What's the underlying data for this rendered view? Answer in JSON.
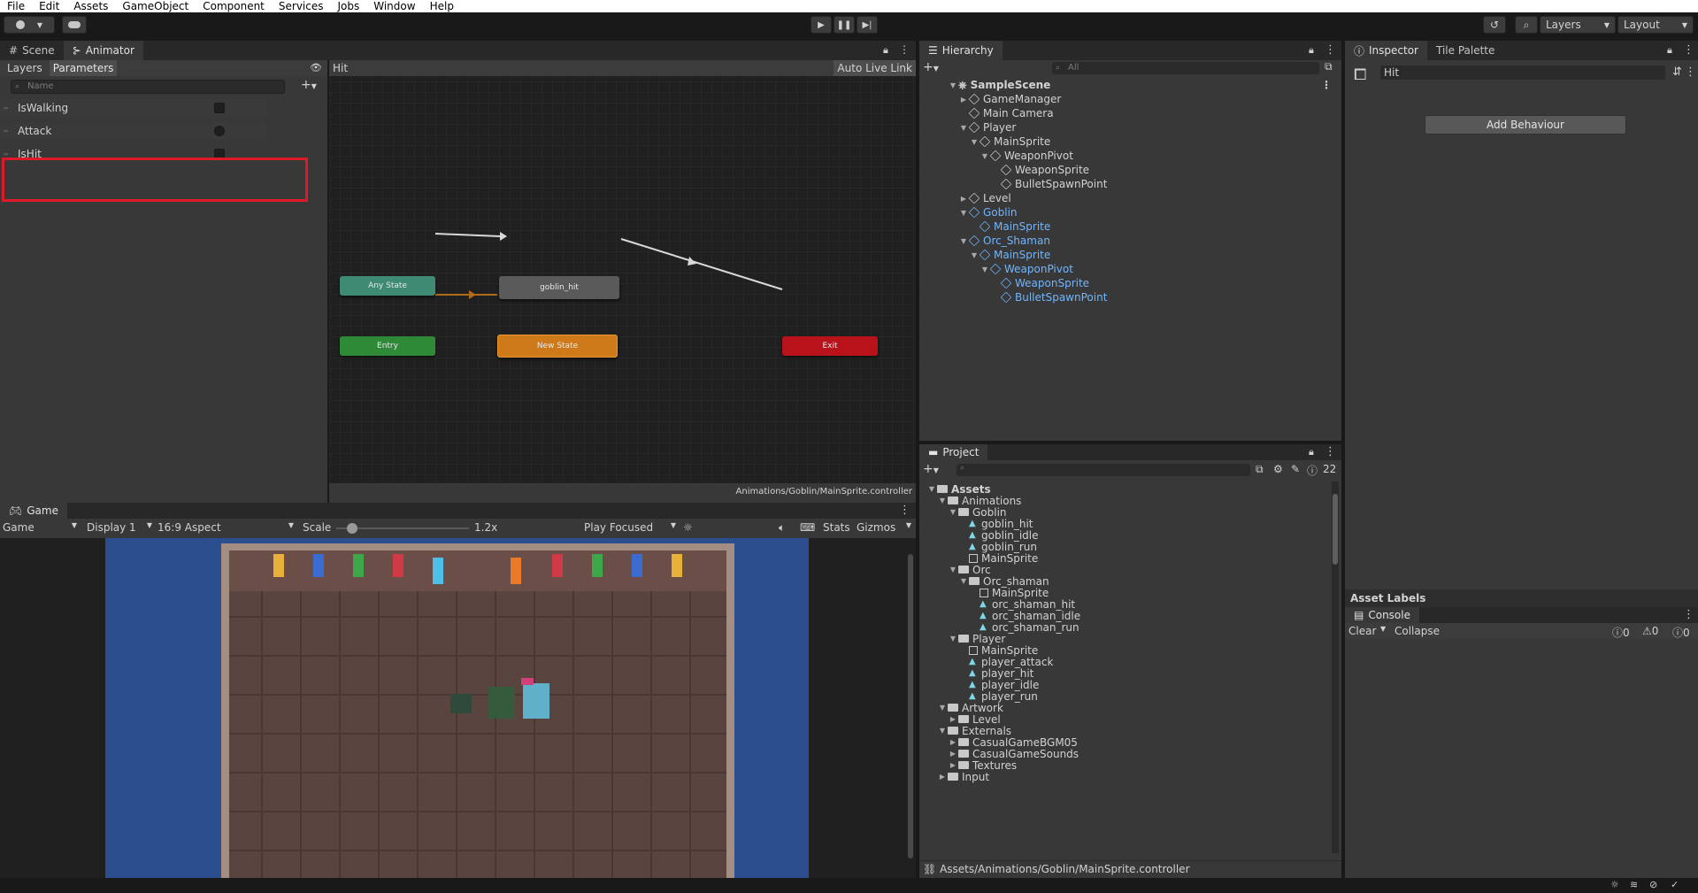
{
  "menu": [
    "File",
    "Edit",
    "Assets",
    "GameObject",
    "Component",
    "Services",
    "Jobs",
    "Window",
    "Help"
  ],
  "toolbar": {
    "layers": "Layers",
    "layout": "Layout"
  },
  "animator": {
    "tabs": {
      "scene": "Scene",
      "animator": "Animator"
    },
    "subtabs": {
      "layers": "Layers",
      "parameters": "Parameters"
    },
    "search_placeholder": "Name",
    "layer_name": "Hit",
    "auto_live_link": "Auto Live Link",
    "params": [
      {
        "name": "IsWalking",
        "type": "bool"
      },
      {
        "name": "Attack",
        "type": "trigger"
      },
      {
        "name": "IsHit",
        "type": "bool"
      }
    ],
    "nodes": {
      "any": "Any State",
      "hit": "goblin_hit",
      "entry": "Entry",
      "new": "New State",
      "exit": "Exit"
    },
    "path": "Animations/Goblin/MainSprite.controller"
  },
  "hierarchy": {
    "title": "Hierarchy",
    "search_placeholder": "All",
    "scene": "SampleScene",
    "items": [
      {
        "label": "GameManager",
        "depth": 1,
        "arrow": "right",
        "prefab": false
      },
      {
        "label": "Main Camera",
        "depth": 1,
        "arrow": "",
        "prefab": false
      },
      {
        "label": "Player",
        "depth": 1,
        "arrow": "down",
        "prefab": false
      },
      {
        "label": "MainSprite",
        "depth": 2,
        "arrow": "down",
        "prefab": false
      },
      {
        "label": "WeaponPivot",
        "depth": 3,
        "arrow": "down",
        "prefab": false
      },
      {
        "label": "WeaponSprite",
        "depth": 4,
        "arrow": "",
        "prefab": false
      },
      {
        "label": "BulletSpawnPoint",
        "depth": 4,
        "arrow": "",
        "prefab": false
      },
      {
        "label": "Level",
        "depth": 1,
        "arrow": "right",
        "prefab": false
      },
      {
        "label": "Goblin",
        "depth": 1,
        "arrow": "down",
        "prefab": true
      },
      {
        "label": "MainSprite",
        "depth": 2,
        "arrow": "",
        "prefab": true
      },
      {
        "label": "Orc_Shaman",
        "depth": 1,
        "arrow": "down",
        "prefab": true
      },
      {
        "label": "MainSprite",
        "depth": 2,
        "arrow": "down",
        "prefab": true
      },
      {
        "label": "WeaponPivot",
        "depth": 3,
        "arrow": "down",
        "prefab": true
      },
      {
        "label": "WeaponSprite",
        "depth": 4,
        "arrow": "",
        "prefab": true
      },
      {
        "label": "BulletSpawnPoint",
        "depth": 4,
        "arrow": "",
        "prefab": true
      }
    ]
  },
  "inspector": {
    "tabs": {
      "inspector": "Inspector",
      "tile": "Tile Palette"
    },
    "name_value": "Hit",
    "add_behaviour": "Add Behaviour",
    "asset_labels": "Asset Labels"
  },
  "console": {
    "title": "Console",
    "clear": "Clear",
    "collapse": "Collapse",
    "counts": [
      "0",
      "0",
      "0"
    ]
  },
  "project": {
    "title": "Project",
    "hidden_count": "22",
    "items": [
      {
        "label": "Assets",
        "depth": 0,
        "kind": "folder",
        "arrow": "down",
        "bold": true
      },
      {
        "label": "Animations",
        "depth": 1,
        "kind": "folder",
        "arrow": "down"
      },
      {
        "label": "Goblin",
        "depth": 2,
        "kind": "folder",
        "arrow": "down"
      },
      {
        "label": "goblin_hit",
        "depth": 3,
        "kind": "anim",
        "arrow": ""
      },
      {
        "label": "goblin_idle",
        "depth": 3,
        "kind": "anim",
        "arrow": ""
      },
      {
        "label": "goblin_run",
        "depth": 3,
        "kind": "anim",
        "arrow": ""
      },
      {
        "label": "MainSprite",
        "depth": 3,
        "kind": "ctl",
        "arrow": ""
      },
      {
        "label": "Orc",
        "depth": 2,
        "kind": "folder",
        "arrow": "down"
      },
      {
        "label": "Orc_shaman",
        "depth": 3,
        "kind": "folder",
        "arrow": "down"
      },
      {
        "label": "MainSprite",
        "depth": 4,
        "kind": "ctl",
        "arrow": ""
      },
      {
        "label": "orc_shaman_hit",
        "depth": 4,
        "kind": "anim",
        "arrow": ""
      },
      {
        "label": "orc_shaman_idle",
        "depth": 4,
        "kind": "anim",
        "arrow": ""
      },
      {
        "label": "orc_shaman_run",
        "depth": 4,
        "kind": "anim",
        "arrow": ""
      },
      {
        "label": "Player",
        "depth": 2,
        "kind": "folder",
        "arrow": "down"
      },
      {
        "label": "MainSprite",
        "depth": 3,
        "kind": "ctl",
        "arrow": ""
      },
      {
        "label": "player_attack",
        "depth": 3,
        "kind": "anim",
        "arrow": ""
      },
      {
        "label": "player_hit",
        "depth": 3,
        "kind": "anim",
        "arrow": ""
      },
      {
        "label": "player_idle",
        "depth": 3,
        "kind": "anim",
        "arrow": ""
      },
      {
        "label": "player_run",
        "depth": 3,
        "kind": "anim",
        "arrow": ""
      },
      {
        "label": "Artwork",
        "depth": 1,
        "kind": "folder",
        "arrow": "down"
      },
      {
        "label": "Level",
        "depth": 2,
        "kind": "folder",
        "arrow": "right"
      },
      {
        "label": "Externals",
        "depth": 1,
        "kind": "folder",
        "arrow": "down"
      },
      {
        "label": "CasualGameBGM05",
        "depth": 2,
        "kind": "folder",
        "arrow": "right"
      },
      {
        "label": "CasualGameSounds",
        "depth": 2,
        "kind": "folder",
        "arrow": "right"
      },
      {
        "label": "Textures",
        "depth": 2,
        "kind": "folder",
        "arrow": "right"
      },
      {
        "label": "Input",
        "depth": 1,
        "kind": "folder",
        "arrow": "right"
      }
    ],
    "path": "Assets/Animations/Goblin/MainSprite.controller"
  },
  "game": {
    "tab": "Game",
    "mode": "Game",
    "display": "Display 1",
    "aspect": "16:9 Aspect",
    "scale_label": "Scale",
    "scale_value": "1.2x",
    "play_focused": "Play Focused",
    "stats": "Stats",
    "gizmos": "Gizmos"
  }
}
